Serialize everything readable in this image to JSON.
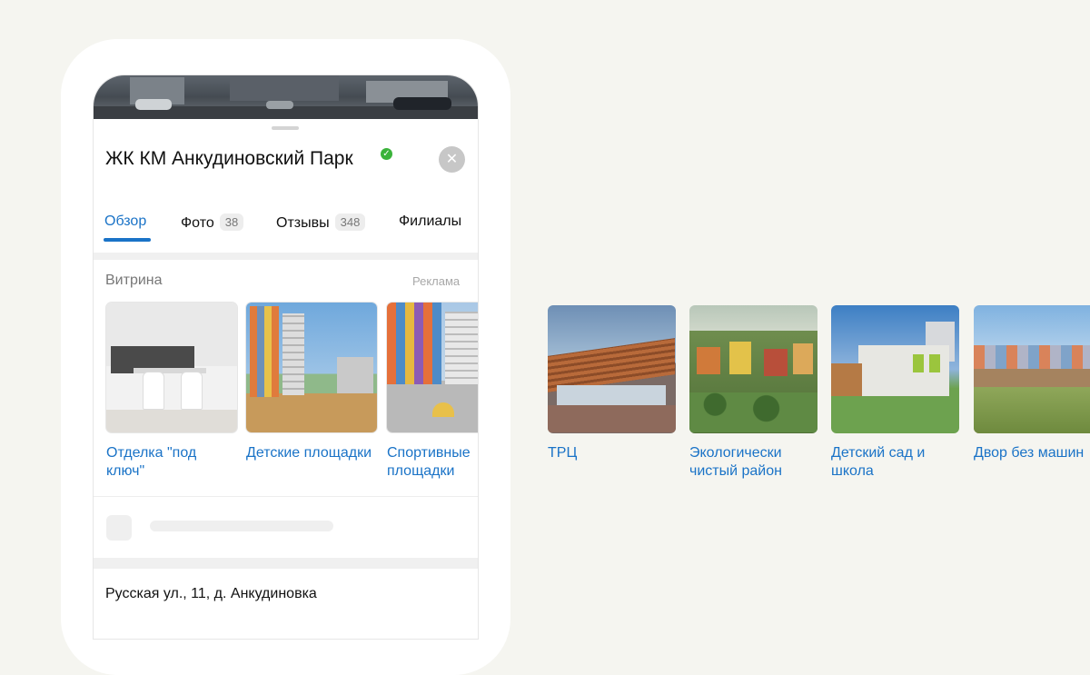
{
  "place": {
    "title": "ЖК КМ Анкудиновский Парк",
    "verified_icon": "verified-check-icon",
    "close_icon": "close-icon"
  },
  "tabs": [
    {
      "label": "Обзор",
      "active": true
    },
    {
      "label": "Фото",
      "count": "38"
    },
    {
      "label": "Отзывы",
      "count": "348"
    },
    {
      "label": "Филиалы"
    }
  ],
  "showcase": {
    "title": "Витрина",
    "ad_label": "Реклама",
    "items": [
      {
        "caption": "Отделка \"под ключ\""
      },
      {
        "caption": "Детские площадки"
      },
      {
        "caption": "Спортивные площадки"
      }
    ]
  },
  "address": "Русская ул., 11, д. Анкудиновка",
  "external_cards": [
    {
      "caption": "ТРЦ"
    },
    {
      "caption": "Экологически чистый район"
    },
    {
      "caption": "Детский сад и школа"
    },
    {
      "caption": "Двор без машин"
    }
  ],
  "colors": {
    "accent": "#1a73c7",
    "verified": "#3bb33b",
    "background": "#f5f5f0"
  }
}
